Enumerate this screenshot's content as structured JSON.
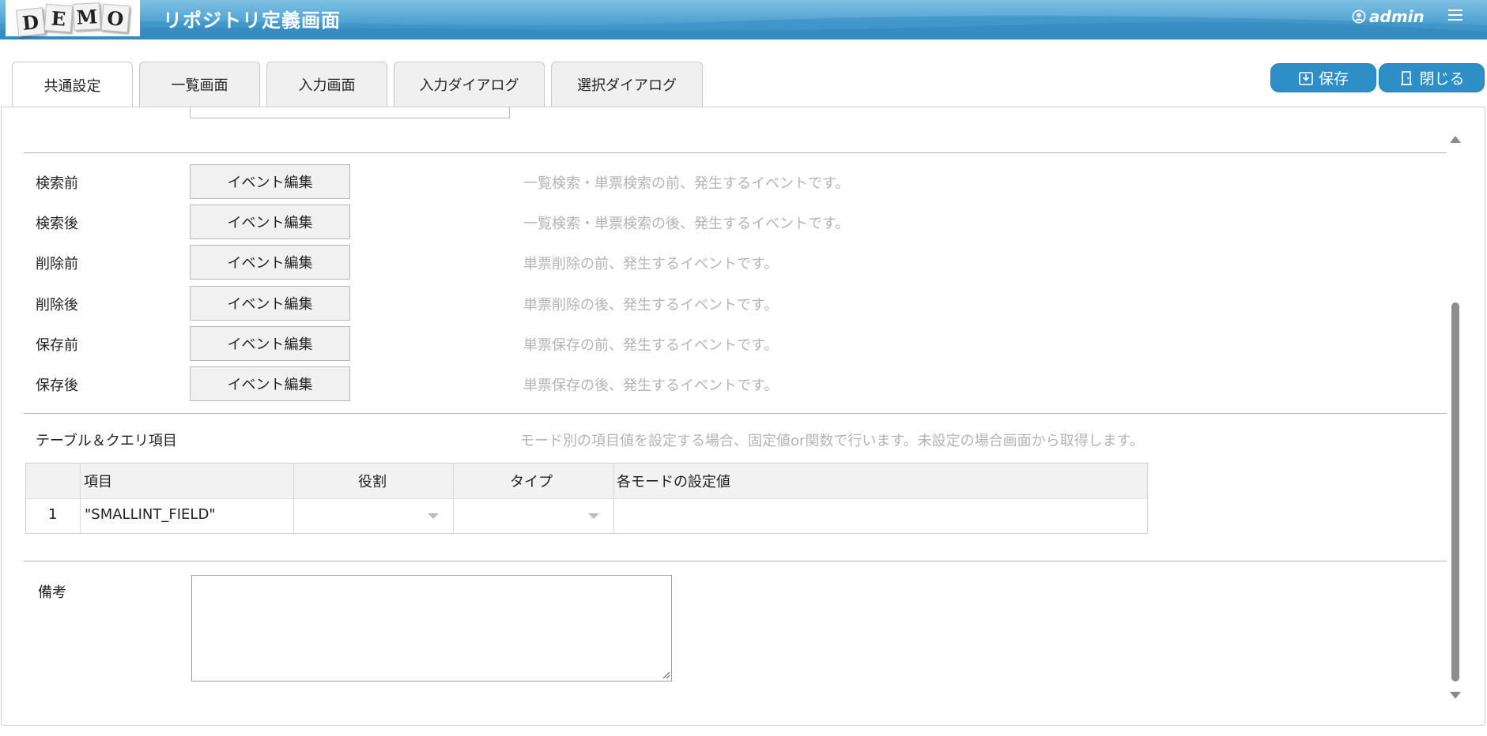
{
  "header": {
    "logo_letters": [
      "D",
      "E",
      "M",
      "O"
    ],
    "title": "リポジトリ定義画面",
    "user": "admin"
  },
  "tabs": [
    {
      "label": "共通設定",
      "active": true
    },
    {
      "label": "一覧画面",
      "active": false
    },
    {
      "label": "入力画面",
      "active": false
    },
    {
      "label": "入力ダイアログ",
      "active": false
    },
    {
      "label": "選択ダイアログ",
      "active": false
    }
  ],
  "toolbar": {
    "save_label": "保存",
    "close_label": "閉じる"
  },
  "events": [
    {
      "label": "検索前",
      "button": "イベント編集",
      "hint": "一覧検索・単票検索の前、発生するイベントです。"
    },
    {
      "label": "検索後",
      "button": "イベント編集",
      "hint": "一覧検索・単票検索の後、発生するイベントです。"
    },
    {
      "label": "削除前",
      "button": "イベント編集",
      "hint": "単票削除の前、発生するイベントです。"
    },
    {
      "label": "削除後",
      "button": "イベント編集",
      "hint": "単票削除の後、発生するイベントです。"
    },
    {
      "label": "保存前",
      "button": "イベント編集",
      "hint": "単票保存の前、発生するイベントです。"
    },
    {
      "label": "保存後",
      "button": "イベント編集",
      "hint": "単票保存の後、発生するイベントです。"
    }
  ],
  "table_section": {
    "title": "テーブル＆クエリ項目",
    "hint": "モード別の項目値を設定する場合、固定値or関数で行います。未設定の場合画面から取得します。",
    "columns": [
      "項目",
      "役割",
      "タイプ",
      "各モードの設定値"
    ],
    "rows": [
      {
        "no": "1",
        "item": "\"SMALLINT_FIELD\"",
        "role": "",
        "type": "",
        "mode_value": ""
      }
    ]
  },
  "notes": {
    "label": "備考",
    "value": ""
  },
  "colors": {
    "header_blue": "#4fa3d3",
    "button_blue": "#2d8fc6",
    "hint_gray": "#b4b4b4"
  }
}
